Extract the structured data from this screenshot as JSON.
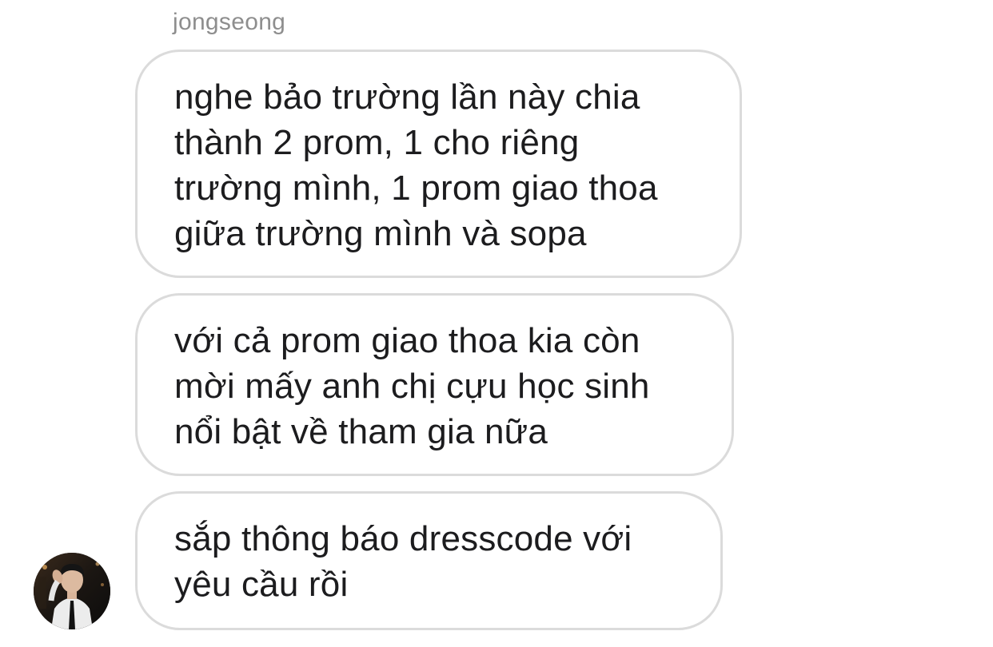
{
  "conversation": {
    "sender_name": "jongseong",
    "messages": [
      {
        "lines": [
          "nghe bảo trường lần này chia",
          "thành 2 prom, 1 cho riêng",
          "trường mình, 1 prom giao thoa",
          "giữa trường mình và sopa"
        ]
      },
      {
        "lines": [
          "với cả prom giao thoa kia còn",
          "mời mấy anh chị cựu học sinh",
          "nổi bật về tham gia nữa"
        ]
      },
      {
        "lines": [
          "sắp thông báo dresscode với",
          "yêu cầu rồi"
        ]
      }
    ]
  },
  "colors": {
    "bubble_border": "#dbdbdb",
    "sender_name": "#8e8e8e",
    "message_text": "#1c1c1e",
    "background": "#ffffff"
  },
  "icons": {
    "avatar": "profile-photo"
  }
}
